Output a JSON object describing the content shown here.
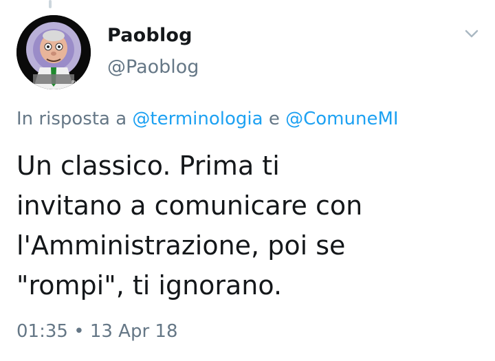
{
  "author": {
    "display_name": "Paoblog",
    "handle": "@Paoblog",
    "avatar_icon": "cartoon-avatar-icon",
    "avatar_badge": "PV"
  },
  "reply": {
    "prefix": "In risposta a ",
    "mention1": "@terminologia",
    "connector": " e ",
    "mention2": "@ComuneMI"
  },
  "tweet": {
    "text": "Un classico. Prima ti\ninvitano a comunicare con\nl'Amministrazione, poi se\n\"rompi\", ti ignorano."
  },
  "meta": {
    "time": "01:35",
    "separator": " • ",
    "date": "13 Apr 18"
  },
  "colors": {
    "link": "#1da1f2",
    "muted": "#657786",
    "text": "#14171a"
  }
}
